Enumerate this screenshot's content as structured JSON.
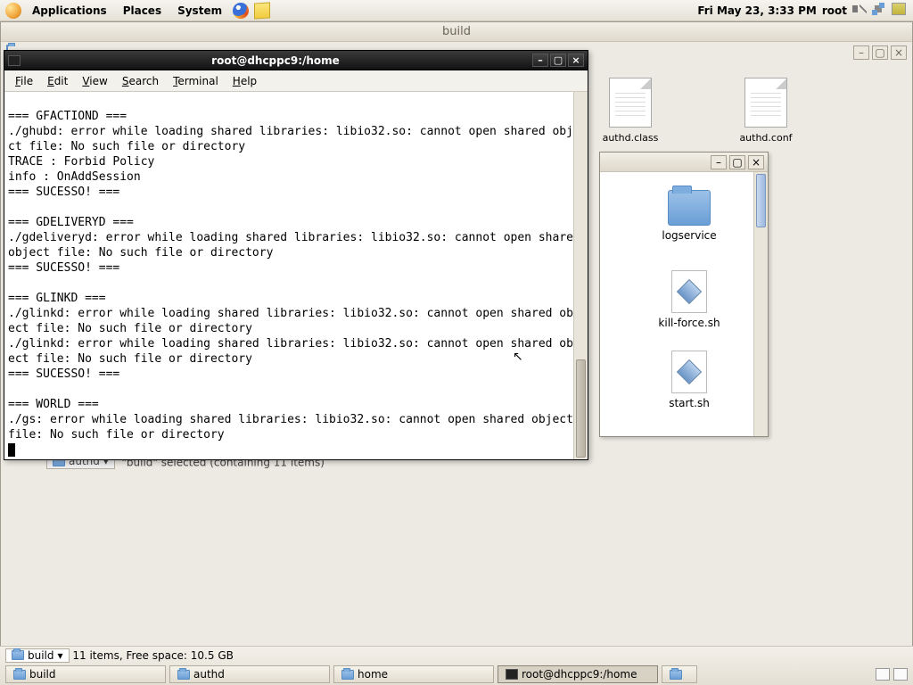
{
  "panel": {
    "menus": {
      "applications": "Applications",
      "places": "Places",
      "system": "System"
    },
    "datetime": "Fri May 23,  3:33 PM",
    "user": "root"
  },
  "buildWindow": {
    "title": "build",
    "icons": {
      "authd_class": "authd.class",
      "authd_conf": "authd.conf"
    },
    "status_line": "\"build\" selected (containing 11 items)"
  },
  "smallNautilus": {
    "items": {
      "logservice": "logservice",
      "killforce": "kill-force.sh",
      "start": "start.sh"
    }
  },
  "terminal": {
    "title": "root@dhcppc9:/home",
    "menu": {
      "file": "File",
      "edit": "Edit",
      "view": "View",
      "search": "Search",
      "terminal": "Terminal",
      "help": "Help"
    },
    "output": "\n=== GFACTIOND ===\n./ghubd: error while loading shared libraries: libio32.so: cannot open shared object file: No such file or directory\nTRACE : Forbid Policy\ninfo : OnAddSession\n=== SUCESSO! ===\n\n=== GDELIVERYD ===\n./gdeliveryd: error while loading shared libraries: libio32.so: cannot open shared object file: No such file or directory\n=== SUCESSO! ===\n\n=== GLINKD ===\n./glinkd: error while loading shared libraries: libio32.so: cannot open shared object file: No such file or directory\n./glinkd: error while loading shared libraries: libio32.so: cannot open shared object file: No such file or directory\n=== SUCESSO! ===\n\n=== WORLD ===\n./gs: error while loading shared libraries: libio32.so: cannot open shared object file: No such file or directory\n"
  },
  "bottom": {
    "location": "build",
    "status": "11 items, Free space: 10.5 GB",
    "tasks": {
      "build": "build",
      "authd": "authd",
      "home": "home",
      "terminal": "root@dhcppc9:/home"
    }
  }
}
